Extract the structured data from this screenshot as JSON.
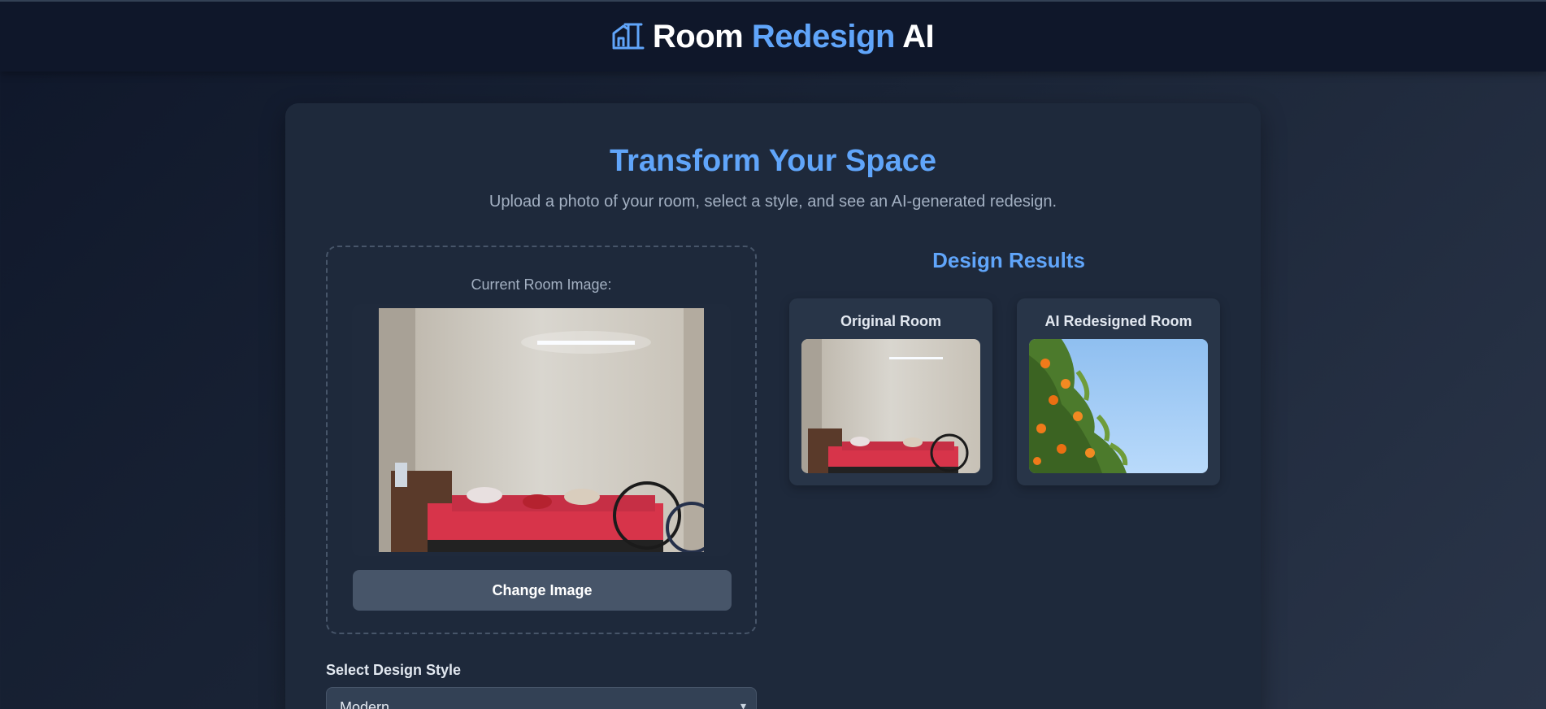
{
  "header": {
    "brand_part1": "Room",
    "brand_part2": "Redesign",
    "brand_part3": "AI",
    "logo_icon": "house-icon"
  },
  "hero": {
    "title": "Transform Your Space",
    "subtitle": "Upload a photo of your room, select a style, and see an AI-generated redesign."
  },
  "upload": {
    "current_label": "Current Room Image:",
    "change_button": "Change Image"
  },
  "style": {
    "label": "Select Design Style",
    "selected": "Modern"
  },
  "results": {
    "title": "Design Results",
    "cards": [
      {
        "title": "Original Room"
      },
      {
        "title": "AI Redesigned Room"
      }
    ]
  },
  "colors": {
    "accent": "#60a5fa",
    "background": "#0f172a",
    "card": "#1e293b",
    "button": "#475569"
  }
}
